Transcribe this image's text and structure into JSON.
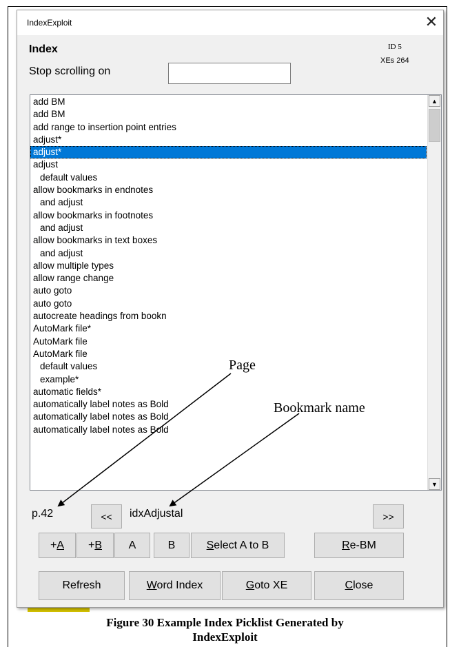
{
  "window": {
    "title": "IndexExploit",
    "close_symbol": "✕"
  },
  "header": {
    "heading": "Index",
    "id_text": "ID 5",
    "xes_text": "XEs 264"
  },
  "stop_scrolling": {
    "label": "Stop scrolling on",
    "value": ""
  },
  "list": {
    "items": [
      {
        "text": "add BM",
        "indent": false,
        "selected": false
      },
      {
        "text": "add BM",
        "indent": false,
        "selected": false
      },
      {
        "text": "add range to insertion point entries",
        "indent": false,
        "selected": false
      },
      {
        "text": "adjust*",
        "indent": false,
        "selected": false
      },
      {
        "text": "adjust*",
        "indent": false,
        "selected": true
      },
      {
        "text": "adjust",
        "indent": false,
        "selected": false
      },
      {
        "text": "default values",
        "indent": true,
        "selected": false
      },
      {
        "text": "allow bookmarks in endnotes",
        "indent": false,
        "selected": false
      },
      {
        "text": "and adjust",
        "indent": true,
        "selected": false
      },
      {
        "text": "allow bookmarks in footnotes",
        "indent": false,
        "selected": false
      },
      {
        "text": "and adjust",
        "indent": true,
        "selected": false
      },
      {
        "text": "allow bookmarks in text boxes",
        "indent": false,
        "selected": false
      },
      {
        "text": "and adjust",
        "indent": true,
        "selected": false
      },
      {
        "text": "allow multiple types",
        "indent": false,
        "selected": false
      },
      {
        "text": "allow range change",
        "indent": false,
        "selected": false
      },
      {
        "text": "auto goto",
        "indent": false,
        "selected": false
      },
      {
        "text": "auto goto",
        "indent": false,
        "selected": false
      },
      {
        "text": "autocreate headings from bookn",
        "indent": false,
        "selected": false
      },
      {
        "text": "AutoMark file*",
        "indent": false,
        "selected": false
      },
      {
        "text": "AutoMark file",
        "indent": false,
        "selected": false
      },
      {
        "text": "AutoMark file",
        "indent": false,
        "selected": false
      },
      {
        "text": "default values",
        "indent": true,
        "selected": false
      },
      {
        "text": "example*",
        "indent": true,
        "selected": false
      },
      {
        "text": "automatic fields*",
        "indent": false,
        "selected": false
      },
      {
        "text": "automatically label notes as Bold",
        "indent": false,
        "selected": false
      },
      {
        "text": "automatically label notes as Bold",
        "indent": false,
        "selected": false
      },
      {
        "text": "automatically label notes as Bold",
        "indent": false,
        "selected": false
      }
    ]
  },
  "nav": {
    "page_label": "p.42",
    "prev_button": "<<",
    "bookmark_name": "idxAdjustal",
    "next_button": ">>"
  },
  "buttons_row1": {
    "plus_a": {
      "prefix": "+",
      "accel": "A",
      "rest": ""
    },
    "plus_b": {
      "prefix": "+",
      "accel": "B",
      "rest": ""
    },
    "a": "A",
    "b": "B",
    "select_a_to_b": {
      "prefix": "",
      "accel": "S",
      "rest": "elect A to B"
    },
    "re_bm": {
      "prefix": "",
      "accel": "R",
      "rest": "e-BM"
    }
  },
  "buttons_row2": {
    "refresh": "Refresh",
    "word_index": {
      "prefix": "",
      "accel": "W",
      "rest": "ord Index"
    },
    "goto_xe": {
      "prefix": "",
      "accel": "G",
      "rest": "oto XE"
    },
    "close": {
      "prefix": "",
      "accel": "C",
      "rest": "lose"
    }
  },
  "annotations": {
    "page": "Page",
    "bookmark_name": "Bookmark name"
  },
  "caption": {
    "line1": "Figure 30 Example Index Picklist Generated by",
    "line2": "IndexExploit"
  },
  "colors": {
    "selection": "#0078d7",
    "button_face": "#e1e1e1",
    "dialog_bg": "#f0f0f0"
  }
}
